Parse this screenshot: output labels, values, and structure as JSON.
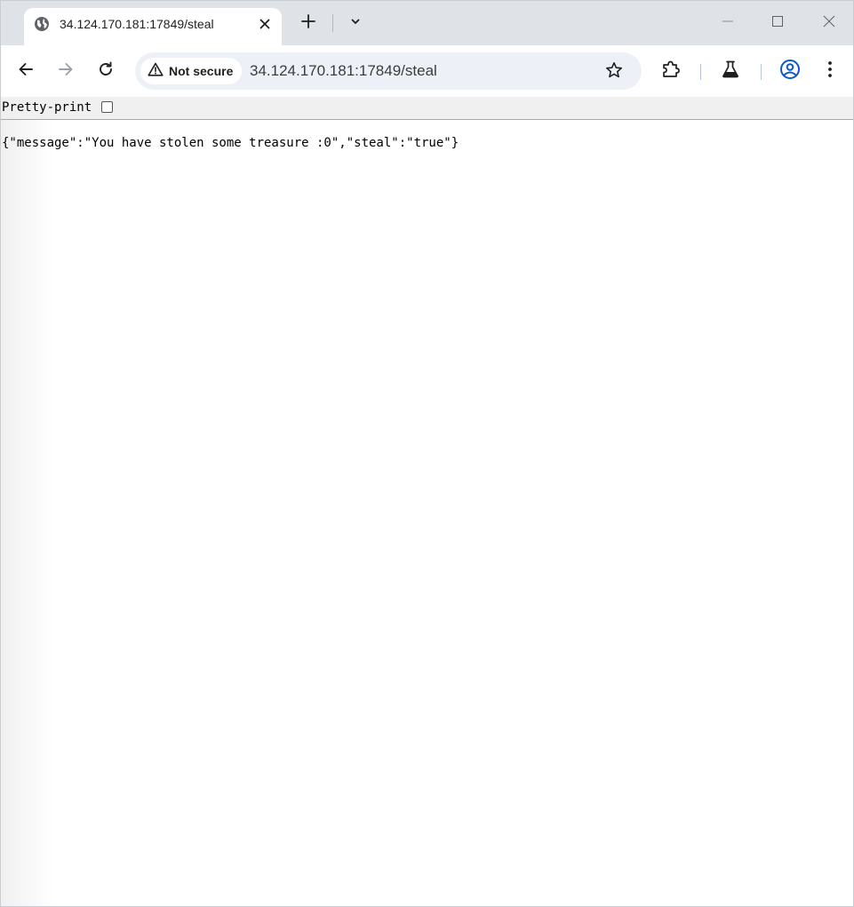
{
  "browser": {
    "tab": {
      "title": "34.124.170.181:17849/steal",
      "favicon": "globe-icon"
    },
    "icons": {
      "tab_close": "close-icon",
      "new_tab": "plus-icon",
      "tab_search": "chevron-down-icon",
      "minimize": "minimize-icon",
      "maximize": "maximize-icon",
      "window_close": "close-icon",
      "back": "arrow-left-icon",
      "forward": "arrow-right-icon",
      "reload": "reload-icon",
      "security": "warning-icon",
      "bookmark": "star-icon",
      "extensions": "puzzle-icon",
      "labs": "flask-icon",
      "profile": "account-icon",
      "menu": "kebab-menu-icon"
    },
    "omnibox": {
      "security_label": "Not secure",
      "url": "34.124.170.181:17849/steal"
    },
    "colors": {
      "tabstrip_bg": "#dfe3e8",
      "omnibox_bg": "#edf1f7",
      "profile_accent": "#0b57d0",
      "forward_disabled": "#9aa0a6"
    }
  },
  "page": {
    "pretty_print_label": "Pretty-print",
    "pretty_print_checked": false,
    "json_text": "{\"message\":\"You have stolen some treasure :0\",\"steal\":\"true\"}"
  }
}
